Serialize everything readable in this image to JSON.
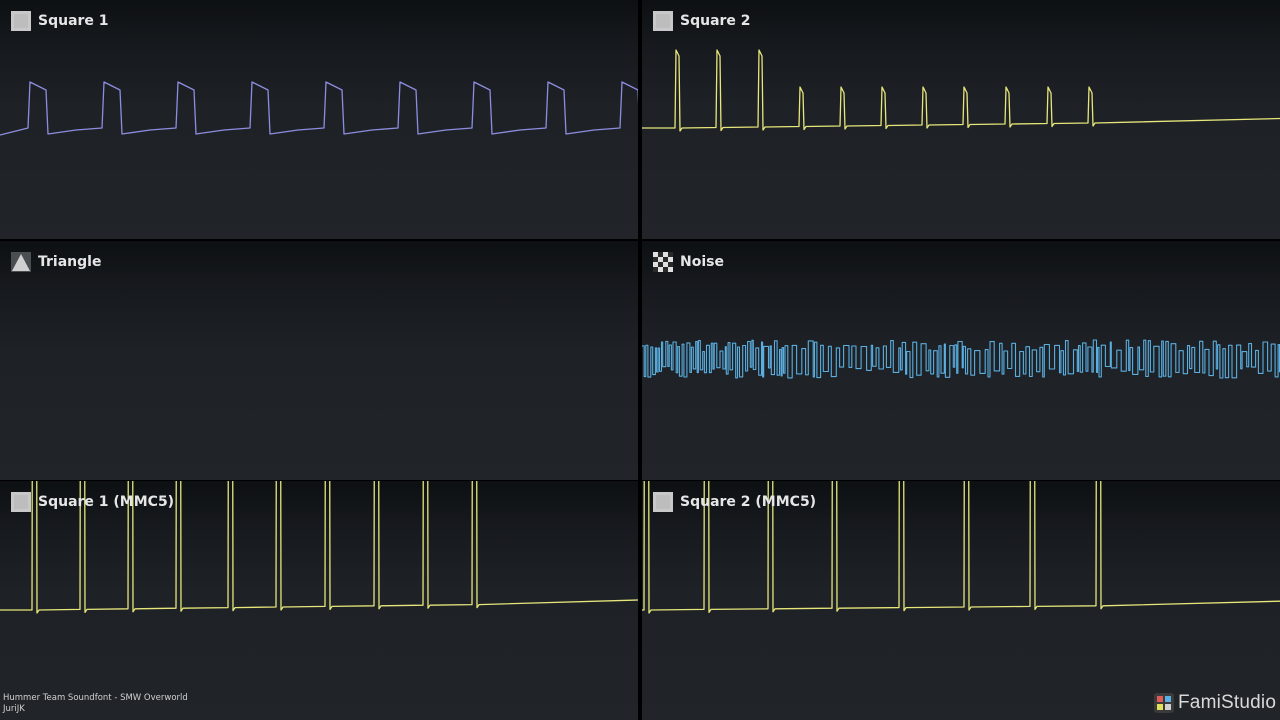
{
  "channels": [
    {
      "label": "Square 1",
      "icon": "square-wave-icon",
      "color": "#8d8de0",
      "wave": "saw"
    },
    {
      "label": "Square 2",
      "icon": "square-wave-icon",
      "color": "#e6e67a",
      "wave": "pulse"
    },
    {
      "label": "Triangle",
      "icon": "triangle-wave-icon",
      "color": "#c9cbe6",
      "wave": "triangle"
    },
    {
      "label": "Noise",
      "icon": "noise-icon",
      "color": "#5aaee0",
      "wave": "noise"
    },
    {
      "label": "Square 1 (MMC5)",
      "icon": "square-wave-icon",
      "color": "#e6e67a",
      "wave": "pulse"
    },
    {
      "label": "Square 2 (MMC5)",
      "icon": "square-wave-icon",
      "color": "#e6e67a",
      "wave": "pulse"
    }
  ],
  "song": {
    "title": "Hummer Team Soundfont - SMW Overworld",
    "author": "JuriJK"
  },
  "brand": {
    "name": "FamiStudio",
    "icon": "famistudio-logo-icon"
  }
}
